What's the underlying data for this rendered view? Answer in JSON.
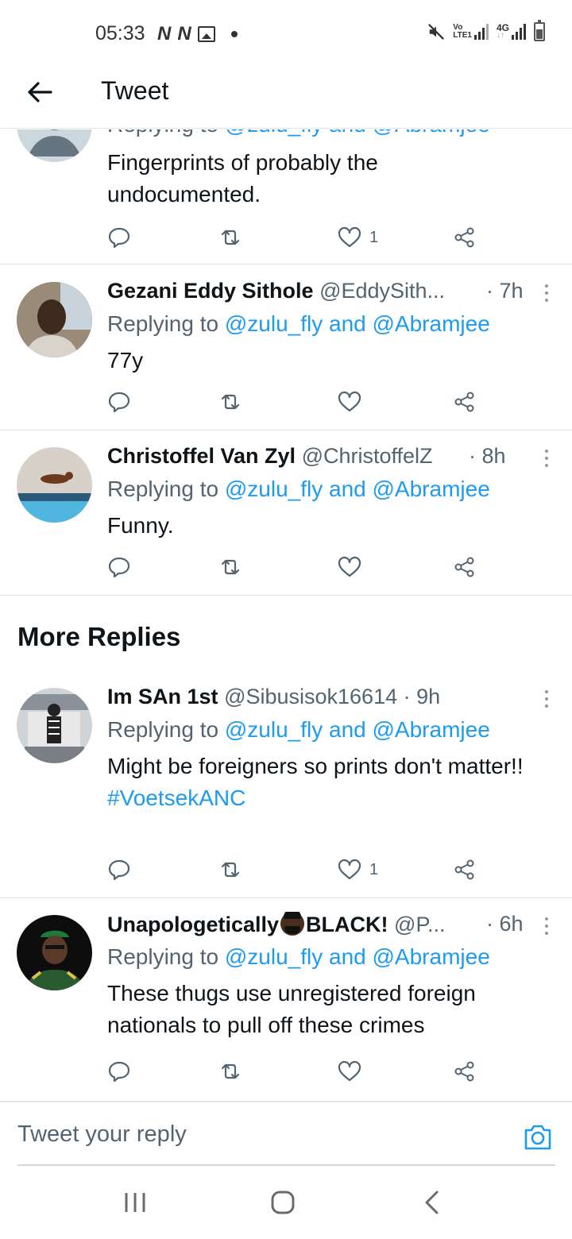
{
  "status_bar": {
    "time": "05:33",
    "left_badges": [
      "N",
      "N"
    ],
    "net_label_top": "Vo",
    "net_label_bottom": "LTE1",
    "net2_label": "4G"
  },
  "header": {
    "title": "Tweet"
  },
  "tweets": [
    {
      "replying_prefix": "Replying to",
      "replying_links": "@zulu_fly and @Abramjee",
      "body": "Fingerprints of probably the undocumented.",
      "like_count": "1"
    },
    {
      "name": "Gezani Eddy Sithole",
      "handle": "@EddySith...",
      "time": "· 7h",
      "replying_prefix": "Replying to",
      "replying_links": "@zulu_fly and @Abramjee",
      "body": "77y",
      "like_count": ""
    },
    {
      "name": "Christoffel Van Zyl",
      "handle": "@ChristoffelZ",
      "time": "· 8h",
      "replying_prefix": "Replying to",
      "replying_links": "@zulu_fly and @Abramjee",
      "body": "Funny.",
      "like_count": ""
    },
    {
      "name": "Im SAn 1st",
      "handle": "@Sibusisok16614",
      "time": "· 9h",
      "replying_prefix": "Replying to",
      "replying_links": "@zulu_fly and @Abramjee",
      "body": "Might be foreigners so prints don't matter!!",
      "hashtag": "#VoetsekANC",
      "like_count": "1"
    },
    {
      "name_part1": "Unapologetically",
      "name_part2": "BLACK!",
      "handle": "@P...",
      "time": "· 6h",
      "replying_prefix": "Replying to",
      "replying_links": "@zulu_fly and @Abramjee",
      "body": "These thugs use unregistered foreign nationals to pull off these crimes",
      "like_count": ""
    }
  ],
  "section": {
    "more_replies": "More Replies"
  },
  "composer": {
    "placeholder": "Tweet your reply"
  },
  "colors": {
    "accent": "#1d9bf0",
    "text": "#0f1419",
    "secondary": "#536471",
    "divider": "#e1e6ea"
  }
}
